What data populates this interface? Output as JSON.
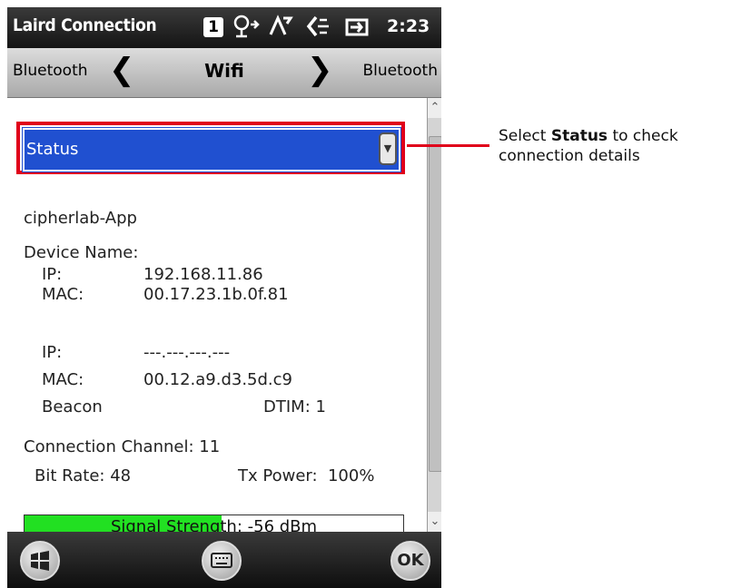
{
  "statusbar": {
    "app_title": "Laird Connection",
    "badge": "1",
    "icons": [
      "connectivity-icon",
      "signal-icon",
      "volume-icon",
      "battery-icon"
    ],
    "time": "2:23"
  },
  "nav": {
    "left_label": "Bluetooth",
    "center_label": "Wifi",
    "right_label": "Bluetooth"
  },
  "dropdown": {
    "selected": "Status"
  },
  "details": {
    "ssid": "cipherlab-App",
    "device_name_label": "Device Name:",
    "ip1_label": "IP:",
    "ip1_value": "192.168.11.86",
    "mac1_label": "MAC:",
    "mac1_value": "00.17.23.1b.0f.81",
    "ip2_label": "IP:",
    "ip2_value": "---.---.---.---",
    "mac2_label": "MAC:",
    "mac2_value": "00.12.a9.d3.5d.c9",
    "beacon_label": "Beacon",
    "dtim": "DTIM: 1",
    "channel": "Connection Channel: 11",
    "bit_rate": "Bit Rate: 48",
    "tx_power": "Tx Power:  100%"
  },
  "signal": {
    "label": "Signal Strength: -56 dBm",
    "fill_percent": 52,
    "fill_color": "#22e022"
  },
  "bottombar": {
    "start_icon": "windows-icon",
    "keyboard_icon": "keyboard-icon",
    "ok_label": "OK"
  },
  "callout": {
    "prefix": "Select ",
    "bold": "Status",
    "suffix": " to check",
    "line2": "connection details",
    "color": "#e0001a"
  },
  "colors": {
    "accent_blue": "#2050d0",
    "highlight_red": "#e0001a"
  }
}
